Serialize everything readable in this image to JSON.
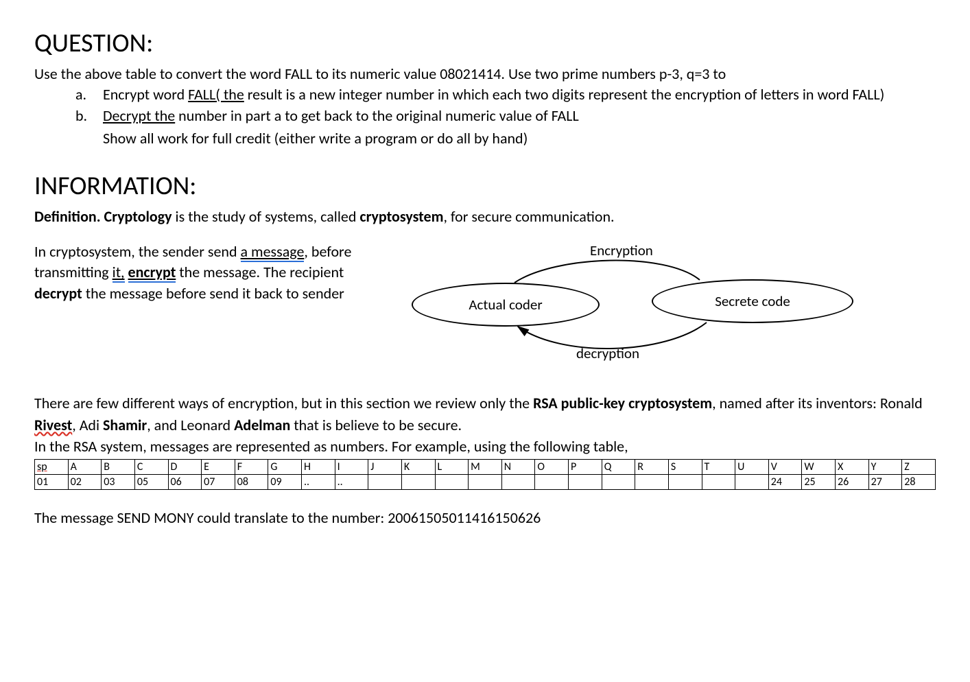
{
  "question": {
    "heading": "QUESTION:",
    "intro": "Use the above table to convert the word FALL to its numeric value 08021414. Use two prime numbers p-3, q=3 to",
    "a_marker": "a.",
    "a_pre": "Encrypt word ",
    "a_under": "FALL( the",
    "a_post": " result is a new integer number in which each two digits represent the encryption of letters in word FALL)",
    "b_marker": "b.",
    "b_under": "Decrypt  the",
    "b_post": " number in part a to  get back to the original numeric value of FALL",
    "b_sub": "Show all work for full credit (either write a program or do all by hand)"
  },
  "info": {
    "heading": "INFORMATION:",
    "def_pre": "Definition.  Cryptology",
    "def_mid": " is the study of systems, called ",
    "def_bold": "cryptosystem",
    "def_post": ", for secure communication.",
    "para_1": "In cryptosystem, the sender send ",
    "para_under1": "a  message",
    "para_after1": ",",
    "para_2": " before transmitting ",
    "para_under2": "it,",
    "para_space": "  ",
    "para_encrypt": "encrypt",
    "para_3": " the message. The recipient ",
    "para_decrypt": "decrypt",
    "para_4": " the message before send it back to sender",
    "diagram": {
      "top": "Encryption",
      "left": "Actual coder",
      "right": "Secrete code",
      "bottom": "decryption"
    },
    "rsa_1": "There are few different ways of encryption, but in this section we review only the ",
    "rsa_bold1": "RSA public-key cryptosystem",
    "rsa_2": ", named after its inventors: Ronald ",
    "rsa_rivest": "Rivest",
    "rsa_3": ", Adi ",
    "rsa_shamir": "Shamir",
    "rsa_4": ", and Leonard ",
    "rsa_adelman": "Adelman",
    "rsa_5": " that is believe to be secure.",
    "rsa_6": "In the RSA system, messages are represented as numbers. For example, using the following table,",
    "example": "The message SEND MONY could translate to the number: 20061505011416150626"
  },
  "table": {
    "row1": [
      "sp",
      "A",
      "B",
      "C",
      "D",
      "E",
      "F",
      "G",
      "H",
      "I",
      "J",
      "K",
      "L",
      "M",
      "N",
      "O",
      "P",
      "Q",
      "R",
      "S",
      "T",
      "U",
      "V",
      "W",
      "X",
      "Y",
      "Z"
    ],
    "row2": [
      "01",
      "02",
      "03",
      "05",
      "06",
      "07",
      "08",
      "09",
      "..",
      "..",
      "",
      "",
      "",
      "",
      "",
      "",
      "",
      "",
      "",
      "",
      "",
      "",
      "24",
      "25",
      "26",
      "27",
      "28"
    ]
  }
}
